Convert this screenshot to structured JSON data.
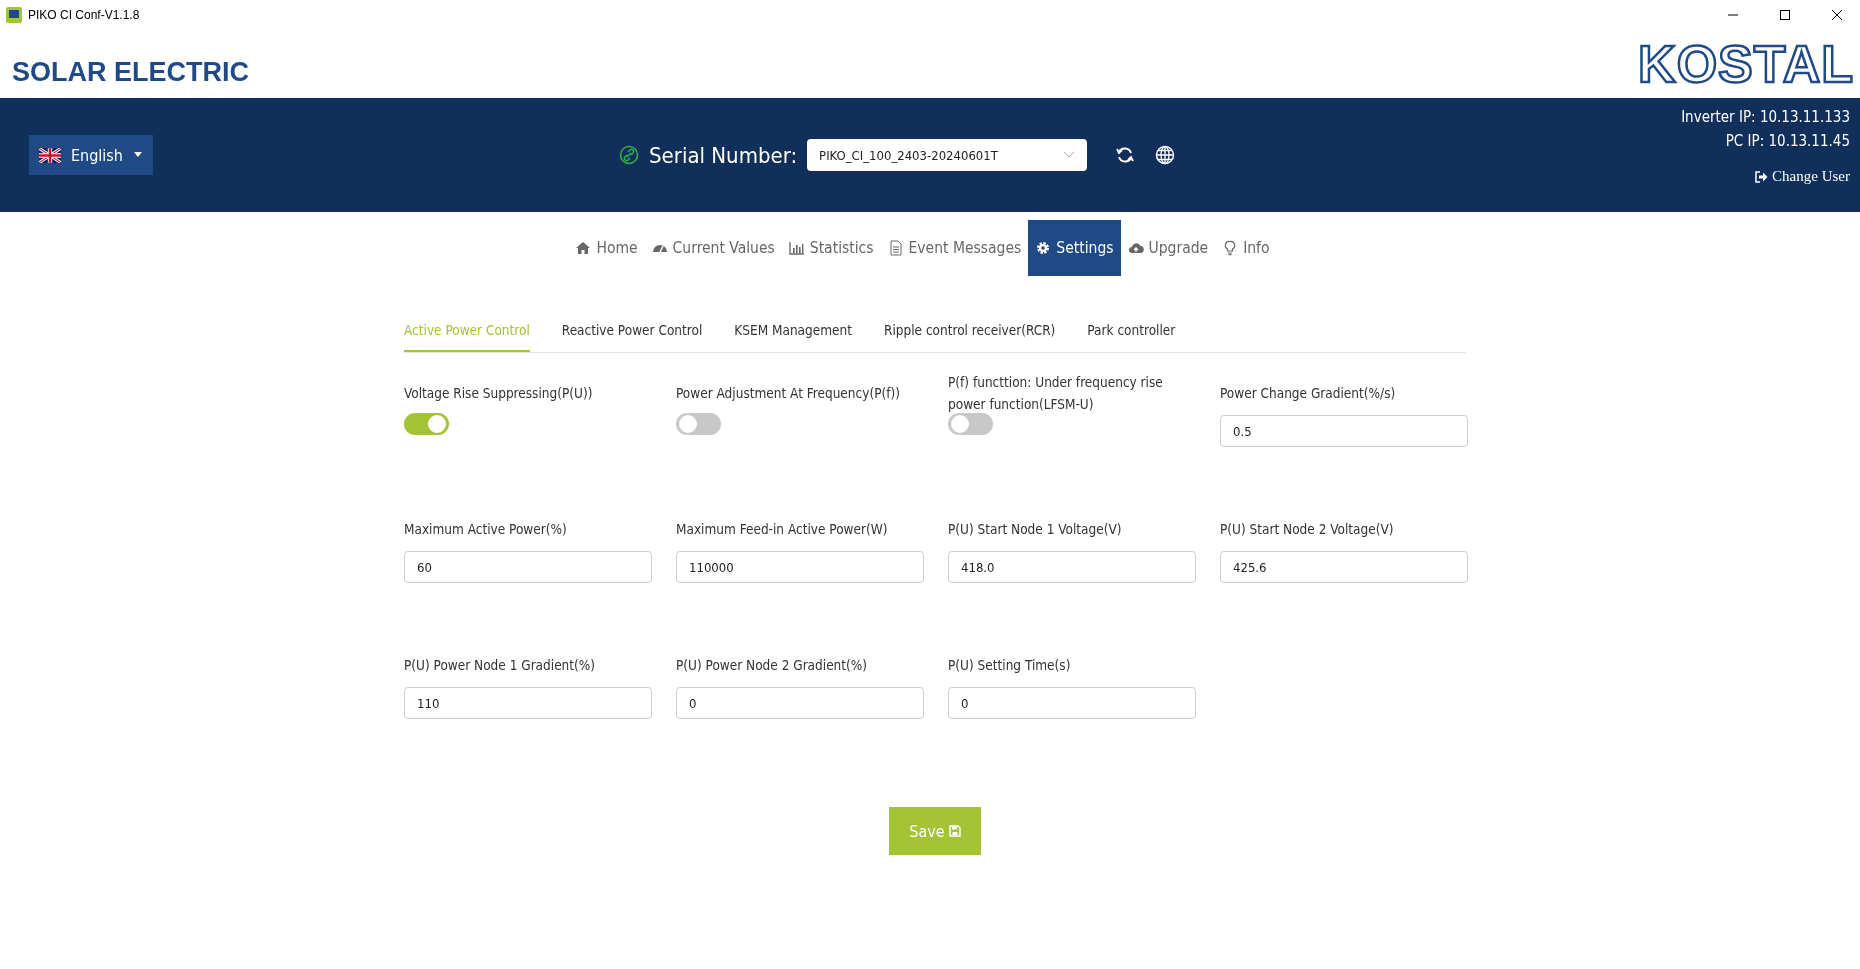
{
  "window": {
    "title": "PIKO CI Conf-V1.1.8"
  },
  "header": {
    "brand": "SOLAR ELECTRIC",
    "logo": "KOSTAL"
  },
  "toolbar": {
    "language": "English",
    "serial_label": "Serial Number:",
    "serial_value": "PIKO_CI_100_2403-20240601T",
    "inverter_ip": "Inverter IP: 10.13.11.133",
    "pc_ip": "PC IP: 10.13.11.45",
    "change_user": "Change User"
  },
  "nav": [
    {
      "label": "Home",
      "selected": false
    },
    {
      "label": "Current Values",
      "selected": false
    },
    {
      "label": "Statistics",
      "selected": false
    },
    {
      "label": "Event Messages",
      "selected": false
    },
    {
      "label": "Settings",
      "selected": true
    },
    {
      "label": "Upgrade",
      "selected": false
    },
    {
      "label": "Info",
      "selected": false
    }
  ],
  "subtabs": [
    {
      "label": "Active Power Control",
      "selected": true
    },
    {
      "label": "Reactive Power Control",
      "selected": false
    },
    {
      "label": "KSEM Management",
      "selected": false
    },
    {
      "label": "Ripple control receiver(RCR)",
      "selected": false
    },
    {
      "label": "Park controller",
      "selected": false
    }
  ],
  "fields": [
    {
      "kind": "toggle",
      "label": "Voltage Rise Suppressing(P(U))",
      "on": true
    },
    {
      "kind": "toggle",
      "label": "Power Adjustment At Frequency(P(f))",
      "on": false
    },
    {
      "kind": "toggle",
      "label": "P(f) functtion: Under frequency rise power function(LFSM-U)",
      "on": false
    },
    {
      "kind": "input",
      "label": "Power Change Gradient(%/s)",
      "value": "0.5"
    },
    {
      "kind": "input",
      "label": "Maximum Active Power(%)",
      "value": "60"
    },
    {
      "kind": "input",
      "label": "Maximum Feed-in Active Power(W)",
      "value": "110000"
    },
    {
      "kind": "input",
      "label": "P(U) Start Node 1 Voltage(V)",
      "value": "418.0"
    },
    {
      "kind": "input",
      "label": "P(U) Start Node 2 Voltage(V)",
      "value": "425.6"
    },
    {
      "kind": "input",
      "label": "P(U) Power Node 1 Gradient(%)",
      "value": "110"
    },
    {
      "kind": "input",
      "label": "P(U) Power Node 2 Gradient(%)",
      "value": "0"
    },
    {
      "kind": "input",
      "label": "P(U) Setting Time(s)",
      "value": "0"
    }
  ],
  "save_button": "Save"
}
